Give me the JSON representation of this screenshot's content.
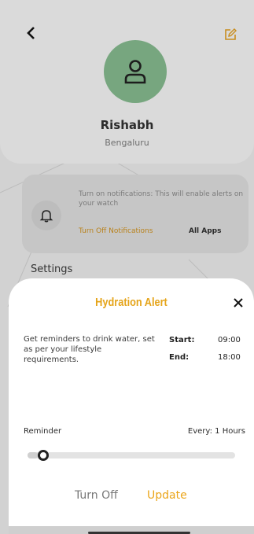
{
  "profile": {
    "name": "Rishabh",
    "city": "Bengaluru",
    "icons": {
      "back": "chevron-left-icon",
      "edit": "edit-icon",
      "avatar": "user-icon"
    },
    "avatar_color": "#77a67f"
  },
  "notifications": {
    "text": "Turn on notifications: This will enable alerts on your watch",
    "turn_off_label": "Turn Off Notifications",
    "all_apps_label": "All Apps",
    "icon": "bell-icon"
  },
  "settings": {
    "heading": "Settings"
  },
  "hydration_sheet": {
    "title": "Hydration Alert",
    "close_icon": "close-icon",
    "description": "Get reminders to drink water, set as per your lifestyle requirements.",
    "start_label": "Start:",
    "start_value": "09:00",
    "end_label": "End:",
    "end_value": "18:00",
    "reminder_label": "Reminder",
    "reminder_value": "Every: 1 Hours",
    "slider_level": 0.05,
    "turn_off_button": "Turn Off",
    "update_button": "Update"
  },
  "colors": {
    "accent": "#e5a419",
    "notif_link": "#b9821c"
  }
}
